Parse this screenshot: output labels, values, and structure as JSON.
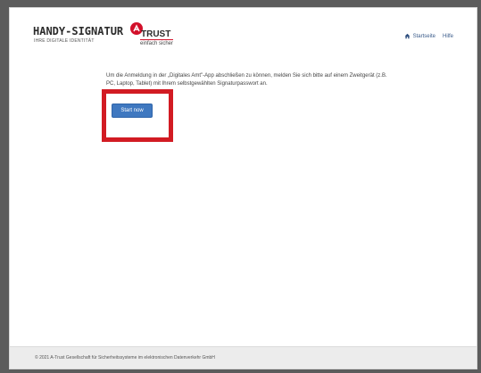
{
  "header": {
    "logo_main": "HANDY-SIGNATUR",
    "logo_sub": "IHRE DIGITALE IDENTITÄT",
    "trust_brand": "TRUST",
    "trust_slogan": "einfach sicher"
  },
  "nav": {
    "home_label": "Startseite",
    "help_label": "Hilfe"
  },
  "main": {
    "message": "Um die Anmeldung in der „Digitales Amt\"-App abschließen zu können, melden Sie sich bitte auf einem Zweitgerät (z.B. PC, Laptop, Tablet) mit Ihrem selbstgewählten Signaturpasswort an.",
    "start_button_label": "Start now"
  },
  "footer": {
    "copyright": "© 2021 A-Trust Gesellschaft für Sicherheitssysteme im elektronischen Datenverkehr GmbH"
  },
  "colors": {
    "brand_red": "#d2102a",
    "button_blue": "#3f78c0",
    "highlight_red": "#d21b23"
  }
}
